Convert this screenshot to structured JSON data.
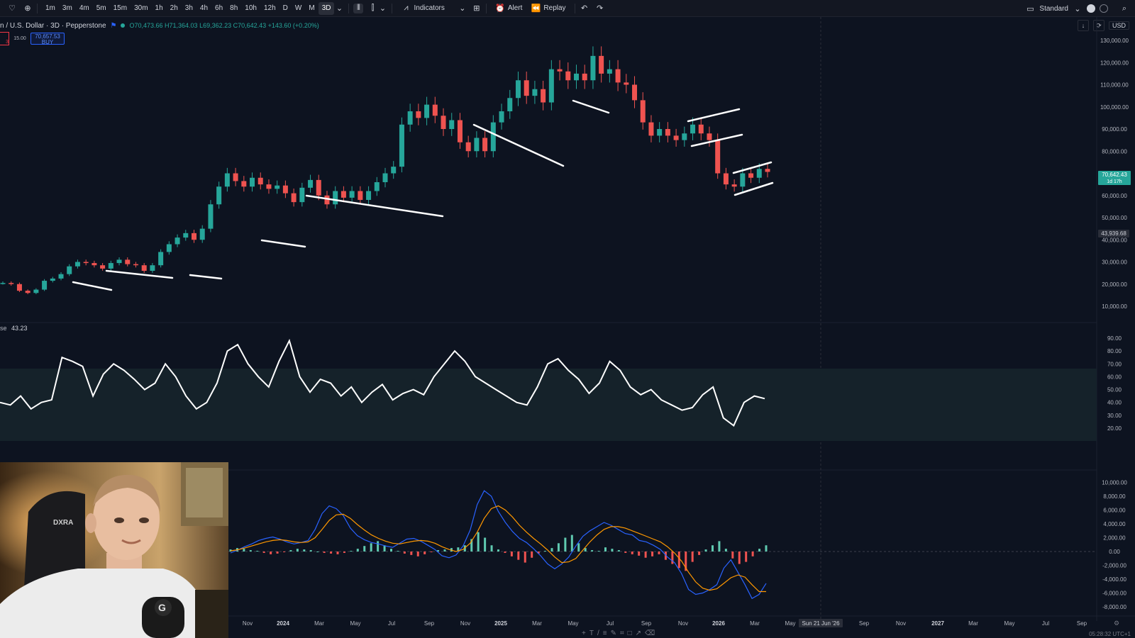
{
  "toolbar": {
    "timeframes": [
      "1m",
      "3m",
      "4m",
      "5m",
      "15m",
      "30m",
      "1h",
      "2h",
      "3h",
      "4h",
      "6h",
      "8h",
      "10h",
      "12h",
      "D",
      "W",
      "M",
      "3D"
    ],
    "active_timeframe": "3D",
    "indicators_label": "Indicators",
    "alert_label": "Alert",
    "replay_label": "Replay",
    "layout_label": "Standard"
  },
  "legend": {
    "symbol": "n / U.S. Dollar · 3D · Pepperstone",
    "ohlc": "O70,473.66 H71,364.03 L69,362.23 C70,642.43 +143.60 (+0.20%)"
  },
  "trade": {
    "sell": "3",
    "spread": "15.00",
    "buy_price": "70,657.53",
    "buy_label": "BUY"
  },
  "currency": "USD",
  "price_axis": {
    "labels": [
      "130,000.00",
      "120,000.00",
      "110,000.00",
      "100,000.00",
      "90,000.00",
      "80,000.00",
      "70,000.00",
      "60,000.00",
      "50,000.00",
      "40,000.00",
      "30,000.00",
      "20,000.00",
      "10,000.00"
    ],
    "current_price": "70,642.43",
    "countdown": "1d 17h",
    "crosshair_price": "43,939.68"
  },
  "rsi": {
    "label": "se",
    "value": "43.23",
    "axis": [
      "90.00",
      "80.00",
      "70.00",
      "60.00",
      "50.00",
      "40.00",
      "30.00",
      "20.00"
    ]
  },
  "macd": {
    "axis": [
      "10,000.00",
      "8,000.00",
      "6,000.00",
      "4,000.00",
      "2,000.00",
      "0.00",
      "-2,000.00",
      "-4,000.00",
      "-6,000.00",
      "-8,000.00"
    ]
  },
  "time_axis": {
    "labels": [
      "Nov",
      "2024",
      "Mar",
      "May",
      "Jul",
      "Sep",
      "Nov",
      "2025",
      "Mar",
      "May",
      "Jul",
      "Sep",
      "Nov",
      "2026",
      "Mar",
      "May",
      "Sep",
      "Nov",
      "2027",
      "Mar",
      "May",
      "Jul",
      "Sep"
    ],
    "crosshair_date": "Sun 21 Jun '26"
  },
  "clock": "05:28:32 UTC+1",
  "colors": {
    "up": "#26a69a",
    "down": "#ef5350",
    "background": "#0d1320",
    "accent": "#2962ff"
  },
  "chart_data": {
    "type": "candlestick",
    "price_series_note": "",
    "price_closes": [
      20500,
      20000,
      17000,
      16000,
      17500,
      21500,
      22500,
      24500,
      28000,
      30000,
      29500,
      28500,
      27000,
      29500,
      31000,
      29000,
      28500,
      26000,
      28500,
      34500,
      38000,
      41000,
      43000,
      40000,
      45000,
      56000,
      64000,
      70000,
      66500,
      64000,
      68000,
      65000,
      63000,
      64500,
      61000,
      57000,
      63500,
      67000,
      60000,
      56000,
      62000,
      59000,
      62000,
      58000,
      62000,
      66000,
      70000,
      73000,
      92000,
      98000,
      95000,
      101000,
      96000,
      90000,
      94000,
      84000,
      80000,
      86000,
      80000,
      93000,
      98000,
      104000,
      112000,
      105000,
      108000,
      102000,
      117000,
      116000,
      112000,
      115000,
      112000,
      123000,
      115000,
      117000,
      111000,
      110000,
      103000,
      93000,
      87000,
      90000,
      87000,
      85000,
      88000,
      92000,
      88000,
      85000,
      70000,
      65000,
      64000,
      70000,
      68000,
      72000,
      70642
    ],
    "rsi_values": [
      40,
      38,
      45,
      35,
      40,
      42,
      75,
      72,
      68,
      45,
      62,
      70,
      65,
      58,
      50,
      55,
      70,
      60,
      45,
      35,
      40,
      55,
      80,
      85,
      70,
      60,
      52,
      72,
      88,
      60,
      48,
      58,
      55,
      45,
      52,
      40,
      48,
      54,
      42,
      47,
      50,
      46,
      60,
      70,
      80,
      72,
      60,
      55,
      50,
      45,
      40,
      38,
      52,
      70,
      74,
      65,
      58,
      47,
      55,
      72,
      65,
      52,
      46,
      50,
      42,
      38,
      34,
      36,
      46,
      52,
      28,
      22,
      40,
      45,
      43
    ],
    "macd_hist": [
      300,
      500,
      400,
      200,
      100,
      -200,
      -400,
      -300,
      -100,
      200,
      400,
      300,
      200,
      0,
      -200,
      -300,
      -400,
      -200,
      100,
      400,
      800,
      1200,
      1500,
      900,
      400,
      100,
      -300,
      -500,
      -700,
      -400,
      -100,
      200,
      300,
      500,
      600,
      900,
      1800,
      2800,
      2000,
      900,
      300,
      -200,
      -700,
      -1200,
      -1600,
      -900,
      -300,
      100,
      500,
      1200,
      2000,
      2400,
      1200,
      500,
      200,
      100,
      600,
      400,
      200,
      -200,
      -400,
      -600,
      -900,
      -700,
      -400,
      -1200,
      -1800,
      -2400,
      -2800,
      -1500,
      -500,
      300,
      900,
      1500,
      400,
      -1000,
      -1800,
      -1500,
      -700,
      400,
      900
    ],
    "macd_line": [
      -200,
      200,
      700,
      1100,
      1600,
      1900,
      2100,
      1800,
      1400,
      1100,
      1300,
      1600,
      3200,
      5500,
      6600,
      6200,
      5200,
      3400,
      2300,
      1700,
      1300,
      1100,
      800,
      600,
      1200,
      1800,
      1900,
      1500,
      900,
      300,
      -600,
      -900,
      -500,
      800,
      3100,
      6800,
      8800,
      8000,
      5800,
      4200,
      2900,
      1900,
      1300,
      400,
      -600,
      -1800,
      -2500,
      -1800,
      -800,
      800,
      2200,
      3000,
      3600,
      4200,
      3800,
      3200,
      2600,
      2400,
      1600,
      1400,
      900,
      300,
      -800,
      -1600,
      -3200,
      -5500,
      -6200,
      -6000,
      -5500,
      -4800,
      -2400,
      -1200,
      -3000,
      -4800,
      -6800,
      -6200,
      -4600
    ],
    "signal_line": [
      100,
      250,
      500,
      800,
      1100,
      1400,
      1600,
      1700,
      1600,
      1400,
      1300,
      1400,
      2000,
      3200,
      4500,
      5300,
      5400,
      4800,
      3900,
      3100,
      2400,
      1900,
      1500,
      1200,
      1100,
      1300,
      1500,
      1600,
      1500,
      1200,
      700,
      300,
      0,
      300,
      1200,
      2800,
      4800,
      6200,
      6600,
      6000,
      5000,
      3800,
      2800,
      1900,
      1100,
      200,
      -800,
      -1600,
      -1500,
      -1000,
      200,
      1400,
      2400,
      3200,
      3600,
      3600,
      3400,
      3000,
      2600,
      2200,
      1800,
      1400,
      700,
      -200,
      -1400,
      -3000,
      -4400,
      -5300,
      -5600,
      -5400,
      -4600,
      -3800,
      -3400,
      -3700,
      -4800,
      -5800,
      -5800
    ]
  }
}
